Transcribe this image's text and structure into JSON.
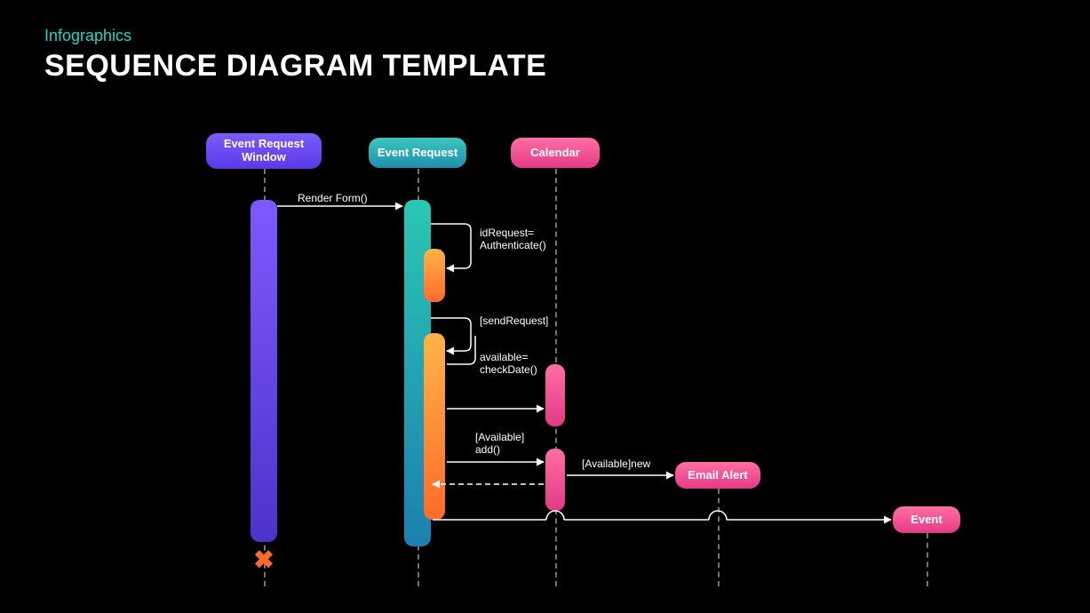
{
  "header": {
    "subtitle": "Infographics",
    "title": "SEQUENCE DIAGRAM TEMPLATE"
  },
  "participants": {
    "eventRequestWindow": {
      "label": "Event Request\nWindow"
    },
    "eventRequest": {
      "label": "Event  Request"
    },
    "calendar": {
      "label": "Calendar"
    },
    "emailAlert": {
      "label": "Email Alert"
    },
    "event": {
      "label": "Event"
    }
  },
  "messages": {
    "renderForm": "Render Form()",
    "authenticate": "idRequest=\nAuthenticate()",
    "sendRequest": "[sendRequest]",
    "checkDate": "available=\ncheckDate()",
    "addAvailable": "[Available]\nadd()",
    "newAvailable": "[Available]new"
  }
}
